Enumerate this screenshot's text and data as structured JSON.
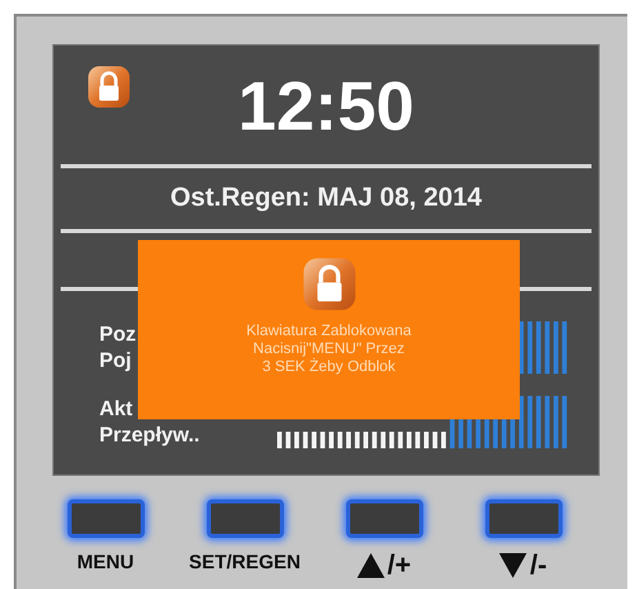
{
  "display": {
    "locked": true,
    "time": "12:50",
    "last_regen": "Ost.Regen: MAJ 08, 2014",
    "meters": [
      {
        "label_lines": [
          "Poz",
          "Poj"
        ]
      },
      {
        "label_lines": [
          "Akt",
          "Przepływ.."
        ],
        "level": 0.58
      }
    ]
  },
  "lock_dialog": {
    "lines": [
      "Klawiatura Zablokowana",
      "Nacisnij\"MENU\" Przez",
      "3 SEK Żeby Odblok"
    ]
  },
  "buttons": [
    {
      "label": "MENU",
      "kind": "text"
    },
    {
      "label": "SET/REGEN",
      "kind": "text"
    },
    {
      "label": "/+",
      "kind": "up"
    },
    {
      "label": "/-",
      "kind": "down"
    }
  ]
}
